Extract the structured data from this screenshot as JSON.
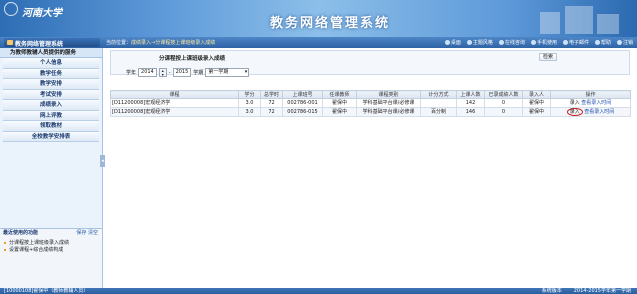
{
  "header": {
    "university": "河南大学",
    "system_title": "教务网络管理系统"
  },
  "sidebar": {
    "title": "教务网络管理系统",
    "section_title": "为教师教辅人员提供的服务",
    "items": [
      {
        "label": "个人信息"
      },
      {
        "label": "教学任务"
      },
      {
        "label": "教学安排"
      },
      {
        "label": "考试安排"
      },
      {
        "label": "成绩录入"
      },
      {
        "label": "网上评教"
      },
      {
        "label": "领取教材"
      },
      {
        "label": "全校教学安排表"
      }
    ],
    "recent": {
      "title": "最近使用的功能",
      "save": "保存",
      "clear": "清空",
      "items": [
        "分课程按上课班级录入成绩",
        "设置课程+综合成绩构成"
      ]
    }
  },
  "breadcrumb": {
    "prefix": "当前位置：",
    "path": "成绩录入→分课程按上课班级录入成绩"
  },
  "toplinks": [
    "桌面",
    "主题风格",
    "在线咨询",
    "手机使用",
    "电子邮件",
    "帮助",
    "注销"
  ],
  "panel": {
    "title": "分课程按上课班级录入成绩",
    "query_button": "检索",
    "year_label": "学年",
    "year_start": "2014",
    "separator": "-",
    "year_end": "2015",
    "term_label": "学期",
    "term_value": "第一学期"
  },
  "table": {
    "headers": [
      "课程",
      "学分",
      "总学时",
      "上课班号",
      "任课教师",
      "课程类别",
      "计分方式",
      "上课人数",
      "已录成绩人数",
      "录入人",
      "操作"
    ],
    "rows": [
      {
        "course": "[D11200008]宏观经济学",
        "credit": "3.0",
        "hours": "72",
        "class_no": "002786-001",
        "teacher": "翟保中",
        "category": "学科基础平台课/必修课",
        "scoring": "",
        "enrolled": "142",
        "recorded": "0",
        "recorder": "翟保中",
        "action": "录入",
        "link": "查看录入时间"
      },
      {
        "course": "[D11200008]宏观经济学",
        "credit": "3.0",
        "hours": "72",
        "class_no": "002786-015",
        "teacher": "翟保中",
        "category": "学科基础平台课/必修课",
        "scoring": "百分制",
        "enrolled": "146",
        "recorded": "0",
        "recorder": "翟保中",
        "action": "录入",
        "link": "查看录入时间"
      }
    ]
  },
  "status": {
    "left": "[10000108]翟保中（教师教辅人员）",
    "version": "系统版本",
    "term": "2014-2015学年第一学期"
  }
}
